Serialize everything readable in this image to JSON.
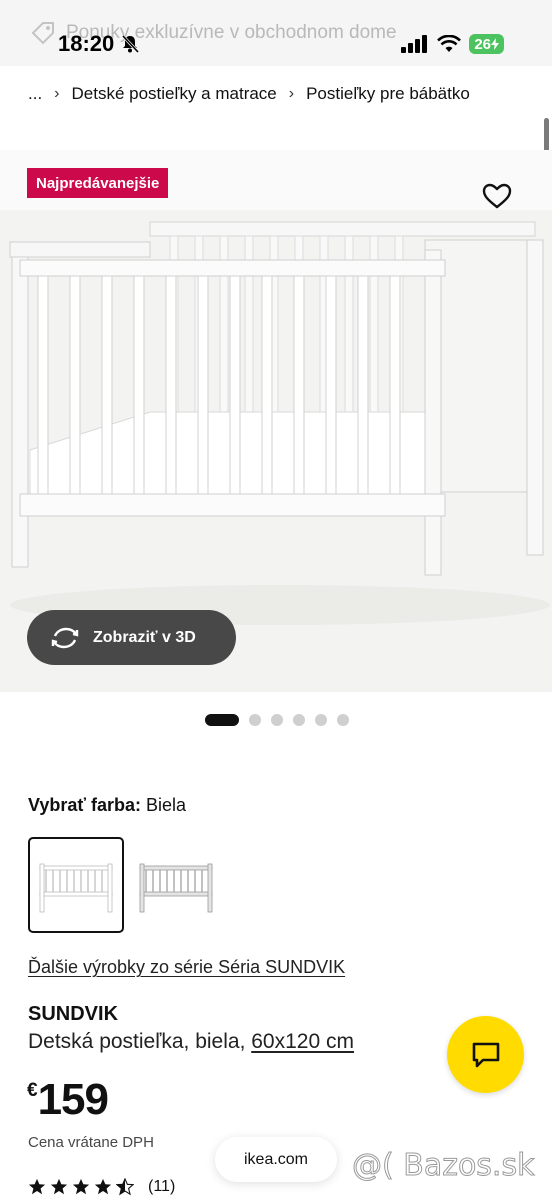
{
  "status_bar": {
    "time": "18:20",
    "ghost_text": "Ponuky exkluzívne v obchodnom dome",
    "battery": "26"
  },
  "breadcrumb": {
    "ellipsis": "...",
    "items": [
      "Detské postieľky a matrace",
      "Postieľky pre bábätko"
    ]
  },
  "gallery": {
    "badge": "Najpredávanejšie",
    "view_3d_label": "Zobraziť v 3D",
    "slide_count": 6,
    "active_slide": 1
  },
  "color_selector": {
    "label": "Vybrať farba:",
    "selected": "Biela"
  },
  "series_link": "Ďalšie výrobky zo série Séria SUNDVIK",
  "product": {
    "name": "SUNDVIK",
    "description_prefix": "Detská postieľka, biela,",
    "size": "60x120 cm",
    "currency": "€",
    "price": "159",
    "vat_note": "Cena vrátane DPH",
    "rating_value": 4.5,
    "review_count": "(11)"
  },
  "browser": {
    "url": "ikea.com"
  },
  "watermark": "@( Bazos.sk",
  "colors": {
    "badge": "#cc0a4b",
    "chat_button": "#ffdb00",
    "view3d_button": "#484848"
  }
}
